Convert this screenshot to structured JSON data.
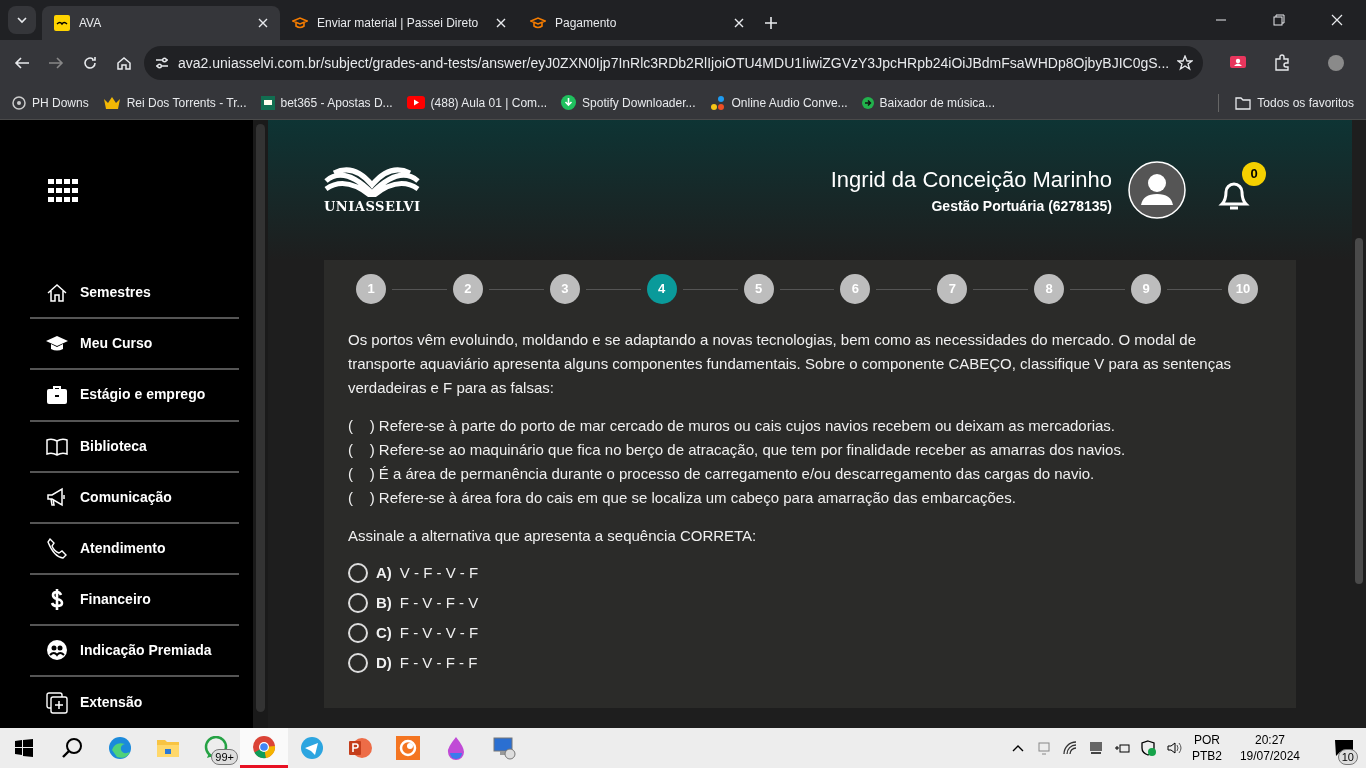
{
  "browser": {
    "tabs": [
      {
        "title": "AVA",
        "selected": true,
        "kind": "ava"
      },
      {
        "title": "Enviar material | Passei Direto",
        "selected": false,
        "kind": "cap"
      },
      {
        "title": "Pagamento",
        "selected": false,
        "kind": "cap"
      }
    ],
    "address": "ava2.uniasselvi.com.br/subject/grades-and-tests/answer/eyJ0ZXN0Ijp7InRlc3RDb2RlIjoiOTU4MDU1IiwiZGVzY3JpcHRpb24iOiJBdmFsaWHDp8OjbyBJIC0gS...",
    "bookmarks": [
      {
        "label": "PH Downs",
        "kind": "disc"
      },
      {
        "label": "Rei Dos Torrents - Tr...",
        "kind": "crown"
      },
      {
        "label": "bet365 - Apostas D...",
        "kind": "bet"
      },
      {
        "label": "(488) Aula 01 | Com...",
        "kind": "play"
      },
      {
        "label": "Spotify Downloader...",
        "kind": "down"
      },
      {
        "label": "Online Audio Conve...",
        "kind": "dots"
      },
      {
        "label": "Baixador de música...",
        "kind": "arrow"
      }
    ],
    "all_bookmarks": "Todos os favoritos"
  },
  "sidebar": {
    "items": [
      {
        "label": "Semestres",
        "kind": "home"
      },
      {
        "label": "Meu Curso",
        "kind": "cap"
      },
      {
        "label": "Estágio e emprego",
        "kind": "case"
      },
      {
        "label": "Biblioteca",
        "kind": "book"
      },
      {
        "label": "Comunicação",
        "kind": "mega"
      },
      {
        "label": "Atendimento",
        "kind": "phone"
      },
      {
        "label": "Financeiro",
        "kind": "dollar"
      },
      {
        "label": "Indicação Premiada",
        "kind": "people"
      },
      {
        "label": "Extensão",
        "kind": "plus"
      }
    ]
  },
  "header": {
    "logo_text": "UNIASSELVI",
    "user_name": "Ingrid da Conceição Marinho",
    "course": "Gestão Portuária (6278135)",
    "notifications": "0"
  },
  "steps": [
    {
      "label": "1",
      "selected": false
    },
    {
      "label": "2",
      "selected": false
    },
    {
      "label": "3",
      "selected": false
    },
    {
      "label": "4",
      "selected": true
    },
    {
      "label": "5",
      "selected": false
    },
    {
      "label": "6",
      "selected": false
    },
    {
      "label": "7",
      "selected": false
    },
    {
      "label": "8",
      "selected": false
    },
    {
      "label": "9",
      "selected": false
    },
    {
      "label": "10",
      "selected": false
    }
  ],
  "question": {
    "intro": "Os portos vêm evoluindo, moldando e se adaptando a novas tecnologias, bem como as necessidades do mercado. O modal de transporte aquaviário apresenta alguns componentes fundamentais. Sobre o componente CABEÇO, classifique V para as sentenças verdadeiras e F para as falsas:",
    "statements": [
      "(    ) Refere-se à parte do porto de mar cercado de muros ou cais cujos navios recebem ou deixam as mercadorias.",
      "(    ) Refere-se ao maquinário que fica no berço de atracação, que tem por finalidade receber as amarras dos navios.",
      "(    ) É a área de permanência durante o processo de carregamento e/ou descarregamento das cargas do navio.",
      "(    ) Refere-se à área fora do cais em que se localiza um cabeço para amarração das embarcações."
    ],
    "prompt": "Assinale a alternativa que apresenta a sequência CORRETA:",
    "options": [
      {
        "letter": "A)",
        "text": "V - F - V - F",
        "selected": false
      },
      {
        "letter": "B)",
        "text": "F - V - F - V",
        "selected": false
      },
      {
        "letter": "C)",
        "text": "F - V - V - F",
        "selected": false
      },
      {
        "letter": "D)",
        "text": "F - V - F - F",
        "selected": false
      }
    ]
  },
  "taskbar": {
    "apps": [
      {
        "kind": "edge",
        "selected": false
      },
      {
        "kind": "folder",
        "selected": false
      },
      {
        "kind": "whatsapp",
        "selected": false,
        "badge": "99+"
      },
      {
        "kind": "chrome",
        "selected": true
      },
      {
        "kind": "telegram",
        "selected": false
      },
      {
        "kind": "powerpoint",
        "selected": false
      },
      {
        "kind": "crunchyroll",
        "selected": false
      },
      {
        "kind": "paint",
        "selected": false
      },
      {
        "kind": "remote",
        "selected": false
      }
    ],
    "language": "POR",
    "layout": "PTB2",
    "time": "20:27",
    "date": "19/07/2024",
    "notification_count": "10"
  }
}
